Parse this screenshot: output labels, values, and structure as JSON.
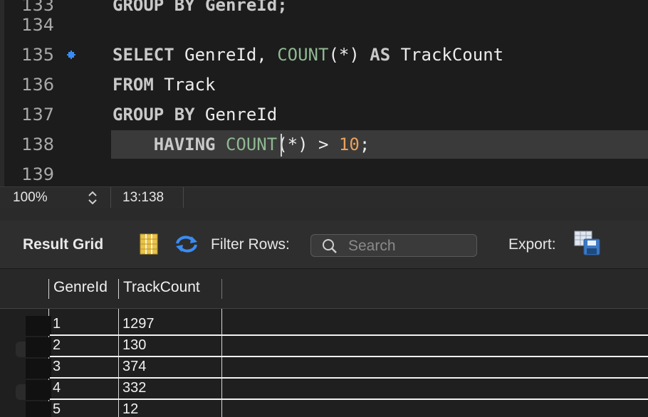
{
  "editor": {
    "lines": [
      {
        "num": "134"
      },
      {
        "num": "135"
      },
      {
        "num": "136"
      },
      {
        "num": "137"
      },
      {
        "num": "138"
      },
      {
        "num": "139"
      }
    ],
    "sql": {
      "l135": {
        "kw1": "SELECT",
        "t1": " GenreId, ",
        "fn": "COUNT",
        "t2": "(*) ",
        "kw2": "AS",
        "t3": " TrackCount"
      },
      "l136": {
        "kw": "FROM",
        "t": " Track"
      },
      "l137": {
        "kw": "GROUP BY",
        "t": " GenreId"
      },
      "l138": {
        "indent": "    ",
        "kw": "HAVING",
        "sp": " ",
        "fn": "COUNT",
        "t": "(*) > ",
        "num": "10",
        "end": ";"
      }
    }
  },
  "statusbar": {
    "zoom": "100%",
    "cursor": "13:138"
  },
  "toolbar": {
    "title": "Result Grid",
    "filter_label": "Filter Rows:",
    "search_placeholder": "Search",
    "export_label": "Export:"
  },
  "grid": {
    "columns": [
      "GenreId",
      "TrackCount"
    ],
    "rows": [
      [
        "1",
        "1297"
      ],
      [
        "2",
        "130"
      ],
      [
        "3",
        "374"
      ],
      [
        "4",
        "332"
      ],
      [
        "5",
        "12"
      ]
    ]
  },
  "colors": {
    "keyword": "#c9c9c9",
    "function": "#8fb892",
    "number": "#e8a15a",
    "breakpoint": "#3b8cf2"
  }
}
